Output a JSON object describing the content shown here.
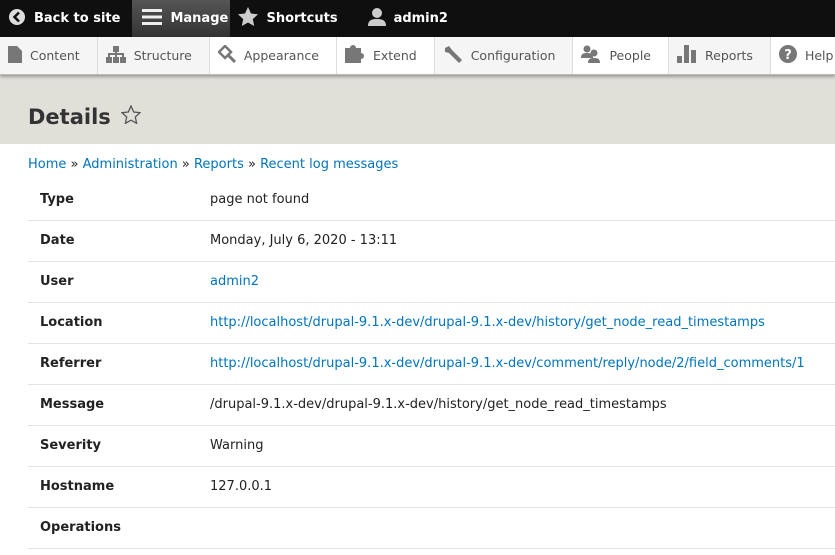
{
  "toolbar": {
    "back": "Back to site",
    "manage": "Manage",
    "shortcuts": "Shortcuts",
    "user": "admin2"
  },
  "tray": [
    {
      "label": "Content",
      "icon": "file-icon"
    },
    {
      "label": "Structure",
      "icon": "sitemap-icon"
    },
    {
      "label": "Appearance",
      "icon": "paintbrush-icon"
    },
    {
      "label": "Extend",
      "icon": "puzzle-icon"
    },
    {
      "label": "Configuration",
      "icon": "wrench-icon"
    },
    {
      "label": "People",
      "icon": "people-icon"
    },
    {
      "label": "Reports",
      "icon": "bar-chart-icon"
    },
    {
      "label": "Help",
      "icon": "help-icon"
    }
  ],
  "page": {
    "title": "Details"
  },
  "breadcrumb": [
    "Home",
    "Administration",
    "Reports",
    "Recent log messages"
  ],
  "details": [
    {
      "label": "Type",
      "value": "page not found"
    },
    {
      "label": "Date",
      "value": "Monday, July 6, 2020 - 13:11"
    },
    {
      "label": "User",
      "value": "admin2",
      "link": true
    },
    {
      "label": "Location",
      "value": "http://localhost/drupal-9.1.x-dev/drupal-9.1.x-dev/history/get_node_read_timestamps",
      "link": true
    },
    {
      "label": "Referrer",
      "value": "http://localhost/drupal-9.1.x-dev/drupal-9.1.x-dev/comment/reply/node/2/field_comments/1",
      "link": true
    },
    {
      "label": "Message",
      "value": "/drupal-9.1.x-dev/drupal-9.1.x-dev/history/get_node_read_timestamps"
    },
    {
      "label": "Severity",
      "value": "Warning"
    },
    {
      "label": "Hostname",
      "value": "127.0.0.1"
    },
    {
      "label": "Operations",
      "value": ""
    }
  ]
}
